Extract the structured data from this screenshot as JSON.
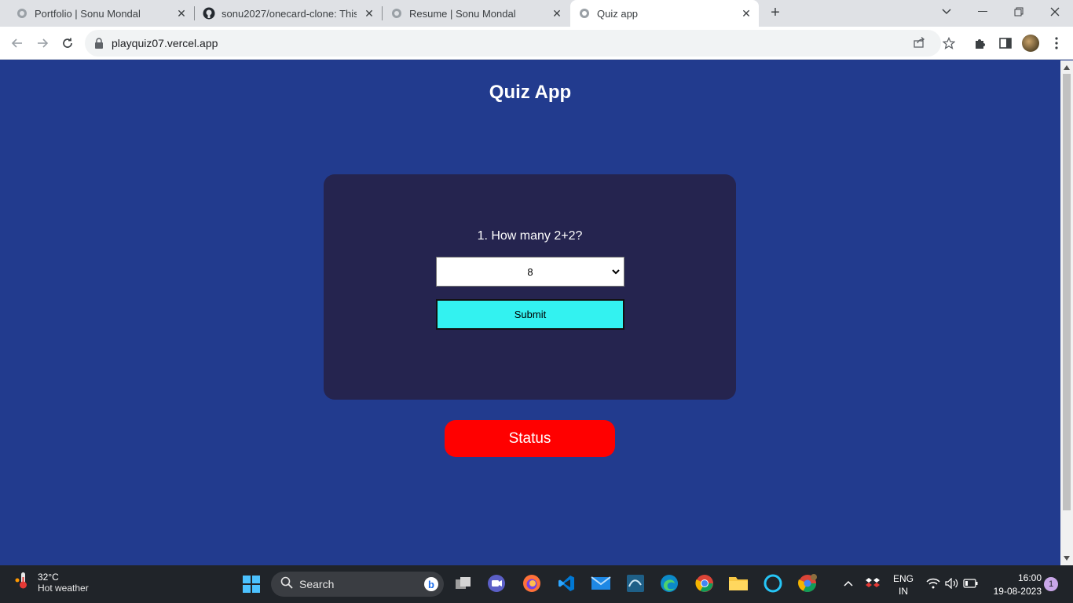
{
  "browser": {
    "tabs": [
      {
        "title": "Portfolio | Sonu Mondal",
        "favicon": "globe-icon",
        "active": false
      },
      {
        "title": "sonu2027/onecard-clone: This w",
        "favicon": "github-icon",
        "active": false
      },
      {
        "title": "Resume | Sonu Mondal",
        "favicon": "globe-icon",
        "active": false
      },
      {
        "title": "Quiz app",
        "favicon": "globe-icon",
        "active": true
      }
    ],
    "url": "playquiz07.vercel.app"
  },
  "page": {
    "title": "Quiz App",
    "question": "1. How many 2+2?",
    "selected_answer": "8",
    "submit_label": "Submit",
    "status_label": "Status",
    "colors": {
      "background": "#223b8e",
      "card": "#25244f",
      "submit": "#33f2f0",
      "status": "#ff0000"
    }
  },
  "taskbar": {
    "weather_temp": "32°C",
    "weather_desc": "Hot weather",
    "search_label": "Search",
    "language": "ENG",
    "region": "IN",
    "time": "16:00",
    "date": "19-08-2023",
    "notification_count": "1"
  }
}
